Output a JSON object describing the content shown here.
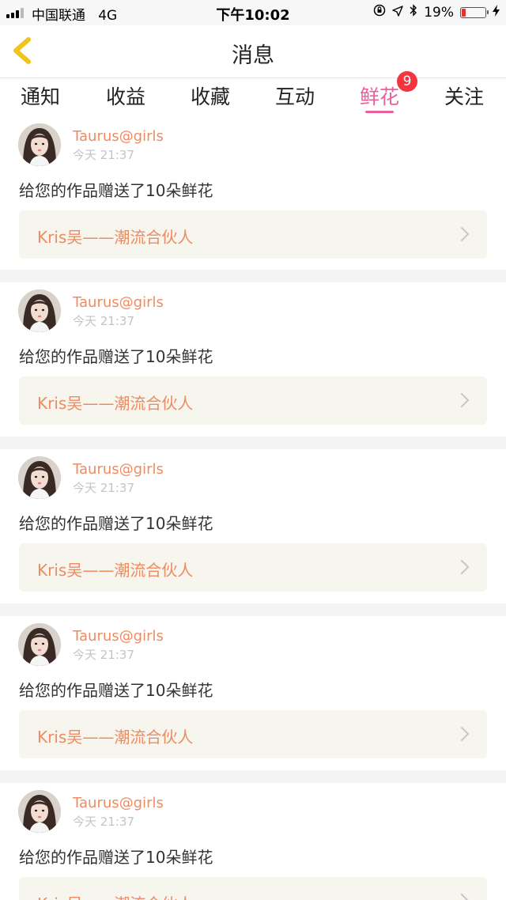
{
  "status_bar": {
    "carrier": "中国联通",
    "network": "4G",
    "time": "下午10:02",
    "battery_percent_label": "19%",
    "battery_level": 0.19,
    "icons": [
      "signal-icon",
      "orientation-lock-icon",
      "location-icon",
      "bluetooth-icon",
      "battery-icon",
      "charging-icon"
    ]
  },
  "header": {
    "title": "消息",
    "back_icon": "chevron-left-icon"
  },
  "tabs": [
    {
      "label": "通知"
    },
    {
      "label": "收益"
    },
    {
      "label": "收藏"
    },
    {
      "label": "互动"
    },
    {
      "label": "鲜花",
      "active": true,
      "badge": "9"
    },
    {
      "label": "关注"
    }
  ],
  "messages": [
    {
      "user": "Taurus@girls",
      "time": "今天 21:37",
      "text": "给您的作品赠送了10朵鲜花",
      "work": "Kris吴——潮流合伙人"
    },
    {
      "user": "Taurus@girls",
      "time": "今天 21:37",
      "text": "给您的作品赠送了10朵鲜花",
      "work": "Kris吴——潮流合伙人"
    },
    {
      "user": "Taurus@girls",
      "time": "今天 21:37",
      "text": "给您的作品赠送了10朵鲜花",
      "work": "Kris吴——潮流合伙人"
    },
    {
      "user": "Taurus@girls",
      "time": "今天 21:37",
      "text": "给您的作品赠送了10朵鲜花",
      "work": "Kris吴——潮流合伙人"
    },
    {
      "user": "Taurus@girls",
      "time": "今天 21:37",
      "text": "给您的作品赠送了10朵鲜花",
      "work": "Kris吴——潮流合伙人"
    }
  ],
  "colors": {
    "accent_pink": "#ea5f9c",
    "username_orange": "#ec8c63",
    "badge_red": "#f2353f",
    "back_arrow_yellow": "#f0c419",
    "link_bg": "#f6f5ee"
  }
}
